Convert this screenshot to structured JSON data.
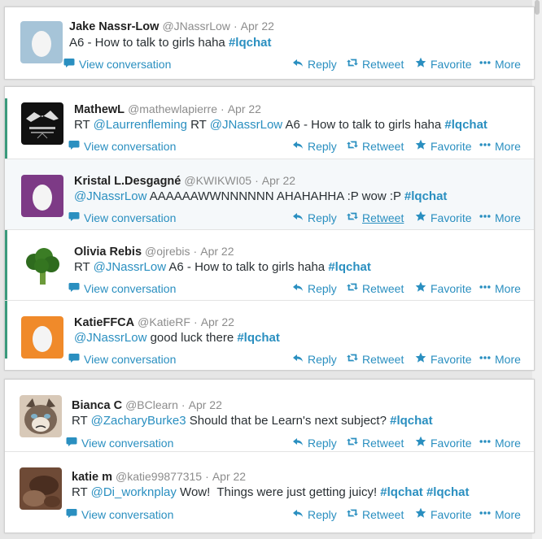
{
  "labels": {
    "view_conversation": "View conversation",
    "reply": "Reply",
    "retweet": "Retweet",
    "favorite": "Favorite",
    "more": "More",
    "dot": "·"
  },
  "tweets": [
    {
      "name": "Jake Nassr-Low",
      "handle": "@JNassrLow",
      "date": "Apr 22",
      "text": [
        {
          "t": "A6 - How to talk to girls haha "
        },
        {
          "h": "#lqchat"
        }
      ]
    },
    {
      "name": "MathewL",
      "handle": "@mathewlapierre",
      "date": "Apr 22",
      "text": [
        {
          "t": "RT "
        },
        {
          "l": "@Laurrenfleming"
        },
        {
          "t": " RT "
        },
        {
          "l": "@JNassrLow"
        },
        {
          "t": " A6 - How to talk to girls haha "
        },
        {
          "h": "#lqchat"
        }
      ]
    },
    {
      "name": "Kristal L.Desgagné",
      "handle": "@KWIKWI05",
      "date": "Apr 22",
      "text": [
        {
          "l": "@JNassrLow"
        },
        {
          "t": " AAAAAAWWNNNNNN AHAHAHHA :P wow :P "
        },
        {
          "h": "#lqchat"
        }
      ]
    },
    {
      "name": "Olivia Rebis",
      "handle": "@ojrebis",
      "date": "Apr 22",
      "text": [
        {
          "t": "RT "
        },
        {
          "l": "@JNassrLow"
        },
        {
          "t": " A6 - How to talk to girls haha "
        },
        {
          "h": "#lqchat"
        }
      ]
    },
    {
      "name": "KatieFFCA",
      "handle": "@KatieRF",
      "date": "Apr 22",
      "text": [
        {
          "l": "@JNassrLow"
        },
        {
          "t": " good luck there "
        },
        {
          "h": "#lqchat"
        }
      ]
    },
    {
      "name": "Bianca C",
      "handle": "@BClearn",
      "date": "Apr 22",
      "text": [
        {
          "t": "RT "
        },
        {
          "l": "@ZacharyBurke3"
        },
        {
          "t": " Should that be Learn's next subject? "
        },
        {
          "h": "#lqchat"
        }
      ]
    },
    {
      "name": "katie m",
      "handle": "@katie99877315",
      "date": "Apr 22",
      "text": [
        {
          "t": "RT "
        },
        {
          "l": "@Di_worknplay"
        },
        {
          "t": " Wow!  Things were just getting juicy! "
        },
        {
          "h": "#lqchat"
        },
        {
          "t": " "
        },
        {
          "h": "#lqchat"
        }
      ]
    }
  ],
  "colors": {
    "link": "#2a8fc0",
    "rail": "#3a9a7c"
  }
}
